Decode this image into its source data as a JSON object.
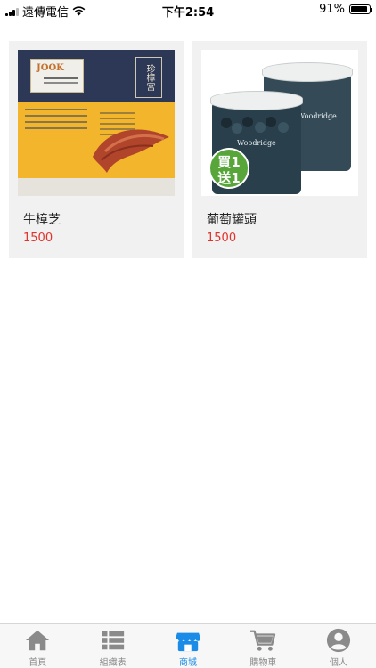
{
  "status_bar": {
    "carrier": "遠傳電信",
    "time": "下午2:54",
    "battery": "91%",
    "battery_level": 0.91
  },
  "products": [
    {
      "name": "牛樟芝",
      "price": "1500"
    },
    {
      "name": "葡萄罐頭",
      "price": "1500"
    }
  ],
  "tabs": [
    {
      "label": "首頁",
      "icon": "home-icon",
      "active": false
    },
    {
      "label": "組織表",
      "icon": "list-icon",
      "active": false
    },
    {
      "label": "商城",
      "icon": "store-icon",
      "active": true
    },
    {
      "label": "購物車",
      "icon": "cart-icon",
      "active": false
    },
    {
      "label": "個人",
      "icon": "person-icon",
      "active": false
    }
  ],
  "colors": {
    "accent": "#1a8be6",
    "price": "#e0332b",
    "tab_inactive": "#8a8a8a"
  }
}
